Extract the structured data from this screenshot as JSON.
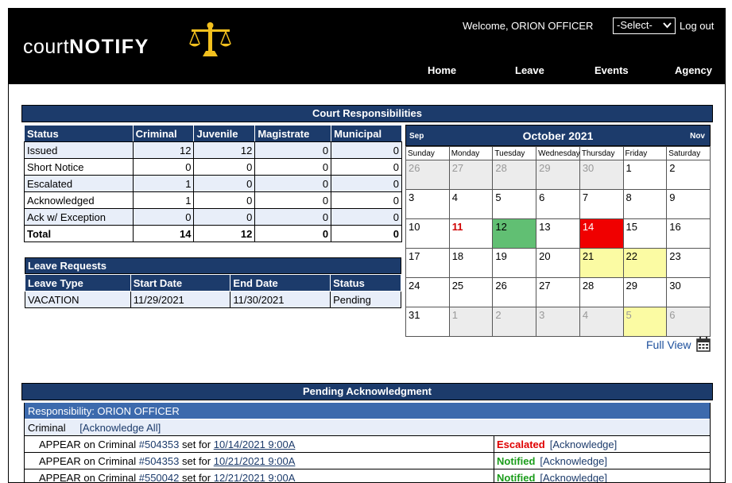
{
  "header": {
    "logo_part1": "court",
    "logo_part2": "NOTIFY",
    "welcome": "Welcome, ORION OFFICER",
    "select_value": "-Select-",
    "logout": "Log out",
    "nav": [
      "Home",
      "Leave",
      "Events",
      "Agency"
    ]
  },
  "court": {
    "title": "Court Responsibilities",
    "columns": [
      "Status",
      "Criminal",
      "Juvenile",
      "Magistrate",
      "Municipal"
    ],
    "rows": [
      {
        "label": "Issued",
        "values": [
          "12",
          "12",
          "0",
          "0"
        ]
      },
      {
        "label": "Short Notice",
        "values": [
          "0",
          "0",
          "0",
          "0"
        ]
      },
      {
        "label": "Escalated",
        "values": [
          "1",
          "0",
          "0",
          "0"
        ]
      },
      {
        "label": "Acknowledged",
        "values": [
          "1",
          "0",
          "0",
          "0"
        ]
      },
      {
        "label": "Ack w/ Exception",
        "values": [
          "0",
          "0",
          "0",
          "0"
        ]
      },
      {
        "label": "Total",
        "values": [
          "14",
          "12",
          "0",
          "0"
        ]
      }
    ]
  },
  "leave": {
    "title": "Leave Requests",
    "columns": [
      "Leave Type",
      "Start Date",
      "End Date",
      "Status"
    ],
    "rows": [
      {
        "values": [
          "VACATION",
          "11/29/2021",
          "11/30/2021",
          "Pending"
        ]
      }
    ]
  },
  "calendar": {
    "prev": "Sep",
    "next": "Nov",
    "title": "October 2021",
    "weekdays": [
      "Sunday",
      "Monday",
      "Tuesday",
      "Wednesday",
      "Thursday",
      "Friday",
      "Saturday"
    ],
    "weeks": [
      [
        {
          "d": "26",
          "s": "other"
        },
        {
          "d": "27",
          "s": "other"
        },
        {
          "d": "28",
          "s": "other"
        },
        {
          "d": "29",
          "s": "other"
        },
        {
          "d": "30",
          "s": "other"
        },
        {
          "d": "1",
          "s": ""
        },
        {
          "d": "2",
          "s": ""
        }
      ],
      [
        {
          "d": "3",
          "s": ""
        },
        {
          "d": "4",
          "s": ""
        },
        {
          "d": "5",
          "s": ""
        },
        {
          "d": "6",
          "s": ""
        },
        {
          "d": "7",
          "s": ""
        },
        {
          "d": "8",
          "s": ""
        },
        {
          "d": "9",
          "s": ""
        }
      ],
      [
        {
          "d": "10",
          "s": ""
        },
        {
          "d": "11",
          "s": "today"
        },
        {
          "d": "12",
          "s": "green"
        },
        {
          "d": "13",
          "s": ""
        },
        {
          "d": "14",
          "s": "red"
        },
        {
          "d": "15",
          "s": ""
        },
        {
          "d": "16",
          "s": ""
        }
      ],
      [
        {
          "d": "17",
          "s": ""
        },
        {
          "d": "18",
          "s": ""
        },
        {
          "d": "19",
          "s": ""
        },
        {
          "d": "20",
          "s": ""
        },
        {
          "d": "21",
          "s": "yellow"
        },
        {
          "d": "22",
          "s": "yellow"
        },
        {
          "d": "23",
          "s": ""
        }
      ],
      [
        {
          "d": "24",
          "s": ""
        },
        {
          "d": "25",
          "s": ""
        },
        {
          "d": "26",
          "s": ""
        },
        {
          "d": "27",
          "s": ""
        },
        {
          "d": "28",
          "s": ""
        },
        {
          "d": "29",
          "s": ""
        },
        {
          "d": "30",
          "s": ""
        }
      ],
      [
        {
          "d": "31",
          "s": ""
        },
        {
          "d": "1",
          "s": "other"
        },
        {
          "d": "2",
          "s": "other"
        },
        {
          "d": "3",
          "s": "other"
        },
        {
          "d": "4",
          "s": "other"
        },
        {
          "d": "5",
          "s": "other yellow"
        },
        {
          "d": "6",
          "s": "other"
        }
      ]
    ],
    "full_view": "Full View"
  },
  "pending": {
    "title": "Pending Acknowledgment",
    "responsibility": "Responsibility: ORION OFFICER",
    "group": "Criminal",
    "ack_all": "[Acknowledge All]",
    "items": [
      {
        "prefix": "APPEAR on Criminal",
        "case": "#504353",
        "mid": "set for",
        "datetime": "10/14/2021 9:00A",
        "status": "Escalated",
        "status_class": "st-escalated",
        "action": "[Acknowledge]"
      },
      {
        "prefix": "APPEAR on Criminal",
        "case": "#504353",
        "mid": "set for",
        "datetime": "10/21/2021 9:00A",
        "status": "Notified",
        "status_class": "st-notified",
        "action": "[Acknowledge]"
      },
      {
        "prefix": "APPEAR on Criminal",
        "case": "#550042",
        "mid": "set for",
        "datetime": "12/21/2021 9:00A",
        "status": "Notified",
        "status_class": "st-notified",
        "action": "[Acknowledge]"
      }
    ]
  },
  "colors": {
    "navy": "#1c3b6b",
    "resp_blue": "#3c6aad",
    "escalated_red": "#e00000",
    "notified_green": "#1a9c1a",
    "cal_green": "#61bf73",
    "cal_red": "#f00000",
    "cal_yellow": "#fbfba3"
  }
}
